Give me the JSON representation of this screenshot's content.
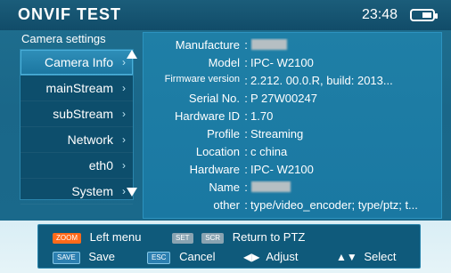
{
  "header": {
    "title": "ONVIF TEST",
    "time": "23:48",
    "battery_icon": "battery-icon"
  },
  "menu": {
    "caption": "Camera settings",
    "items": [
      {
        "label": "Camera Info",
        "selected": true
      },
      {
        "label": "mainStream",
        "selected": false
      },
      {
        "label": "subStream",
        "selected": false
      },
      {
        "label": "Network",
        "selected": false
      },
      {
        "label": "eth0",
        "selected": false
      },
      {
        "label": "System",
        "selected": false
      }
    ],
    "chevron_glyph": "›"
  },
  "info": {
    "rows": [
      {
        "key": "Manufacture",
        "value": ""
      },
      {
        "key": "Model",
        "value": "IPC-    W2100"
      },
      {
        "key": "Firmware version",
        "value": "2.212.         00.0.R, build: 2013..."
      },
      {
        "key": "Serial No.",
        "value": "P          27W00247"
      },
      {
        "key": "Hardware ID",
        "value": "1.70"
      },
      {
        "key": "Profile",
        "value": "Streaming"
      },
      {
        "key": "Location",
        "value": "c          china"
      },
      {
        "key": "Hardware",
        "value": "IPC-    W2100"
      },
      {
        "key": "Name",
        "value": ""
      },
      {
        "key": "other",
        "value": "type/video_encoder; type/ptz; t..."
      }
    ]
  },
  "help": {
    "left_menu": "Left menu",
    "return_to_ptz": "Return to PTZ",
    "save": "Save",
    "cancel": "Cancel",
    "adjust": "Adjust",
    "select": "Select",
    "key_zoom": "ZOOM",
    "key_set": "SET",
    "key_scr": "SCR",
    "key_save": "SAVE",
    "key_cancel": "ESC"
  }
}
